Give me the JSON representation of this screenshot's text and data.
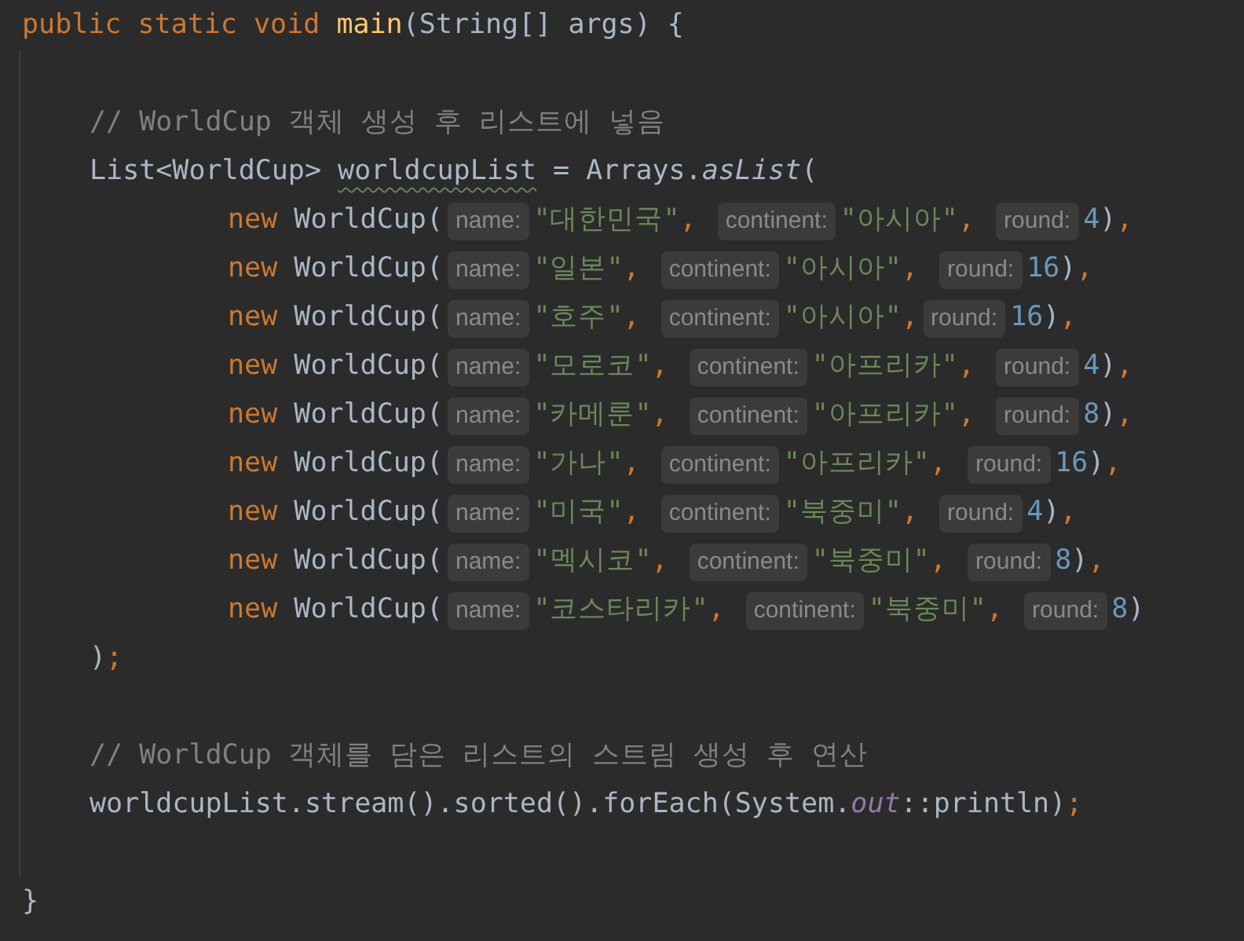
{
  "lines": [
    {
      "kind": "top",
      "tokens": [
        {
          "kind": "keyword",
          "text": "public static void "
        },
        {
          "kind": "method",
          "text": "main"
        },
        {
          "kind": "text",
          "text": "(String[] args) {"
        }
      ]
    },
    {
      "kind": "blank"
    },
    {
      "kind": "body",
      "tokens": [
        {
          "kind": "comment",
          "text": "// WorldCup 객체 생성 후 리스트에 넣음"
        }
      ]
    },
    {
      "kind": "body",
      "tokens": [
        {
          "kind": "text",
          "text": "List<WorldCup> "
        },
        {
          "kind": "typo",
          "text": "worldcupList"
        },
        {
          "kind": "text",
          "text": " = Arrays."
        },
        {
          "kind": "italic",
          "text": "asList"
        },
        {
          "kind": "text",
          "text": "("
        }
      ]
    },
    {
      "kind": "args",
      "tokens": [
        {
          "kind": "keyword",
          "text": "new "
        },
        {
          "kind": "text",
          "text": "WorldCup("
        },
        {
          "kind": "hint",
          "text": "name:"
        },
        {
          "kind": "string",
          "text": "\"대한민국\""
        },
        {
          "kind": "comma",
          "text": ", "
        },
        {
          "kind": "hint",
          "text": "continent:"
        },
        {
          "kind": "string",
          "text": "\"아시아\""
        },
        {
          "kind": "comma",
          "text": ", "
        },
        {
          "kind": "hint",
          "text": "round:"
        },
        {
          "kind": "number",
          "text": "4"
        },
        {
          "kind": "text",
          "text": ")"
        },
        {
          "kind": "comma",
          "text": ","
        }
      ]
    },
    {
      "kind": "args",
      "tokens": [
        {
          "kind": "keyword",
          "text": "new "
        },
        {
          "kind": "text",
          "text": "WorldCup("
        },
        {
          "kind": "hint",
          "text": "name:"
        },
        {
          "kind": "string",
          "text": "\"일본\""
        },
        {
          "kind": "comma",
          "text": ", "
        },
        {
          "kind": "hint",
          "text": "continent:"
        },
        {
          "kind": "string",
          "text": "\"아시아\""
        },
        {
          "kind": "comma",
          "text": ", "
        },
        {
          "kind": "hint",
          "text": "round:"
        },
        {
          "kind": "number",
          "text": "16"
        },
        {
          "kind": "text",
          "text": ")"
        },
        {
          "kind": "comma",
          "text": ","
        }
      ]
    },
    {
      "kind": "args",
      "tokens": [
        {
          "kind": "keyword",
          "text": "new "
        },
        {
          "kind": "text",
          "text": "WorldCup("
        },
        {
          "kind": "hint",
          "text": "name:"
        },
        {
          "kind": "string",
          "text": "\"호주\""
        },
        {
          "kind": "comma",
          "text": ", "
        },
        {
          "kind": "hint",
          "text": "continent:"
        },
        {
          "kind": "string",
          "text": "\"아시아\""
        },
        {
          "kind": "comma",
          "text": ","
        },
        {
          "kind": "hint",
          "text": "round:"
        },
        {
          "kind": "number",
          "text": "16"
        },
        {
          "kind": "text",
          "text": ")"
        },
        {
          "kind": "comma",
          "text": ","
        }
      ]
    },
    {
      "kind": "args",
      "tokens": [
        {
          "kind": "keyword",
          "text": "new "
        },
        {
          "kind": "text",
          "text": "WorldCup("
        },
        {
          "kind": "hint",
          "text": "name:"
        },
        {
          "kind": "string",
          "text": "\"모로코\""
        },
        {
          "kind": "comma",
          "text": ", "
        },
        {
          "kind": "hint",
          "text": "continent:"
        },
        {
          "kind": "string",
          "text": "\"아프리카\""
        },
        {
          "kind": "comma",
          "text": ", "
        },
        {
          "kind": "hint",
          "text": "round:"
        },
        {
          "kind": "number",
          "text": "4"
        },
        {
          "kind": "text",
          "text": ")"
        },
        {
          "kind": "comma",
          "text": ","
        }
      ]
    },
    {
      "kind": "args",
      "tokens": [
        {
          "kind": "keyword",
          "text": "new "
        },
        {
          "kind": "text",
          "text": "WorldCup("
        },
        {
          "kind": "hint",
          "text": "name:"
        },
        {
          "kind": "string",
          "text": "\"카메룬\""
        },
        {
          "kind": "comma",
          "text": ", "
        },
        {
          "kind": "hint",
          "text": "continent:"
        },
        {
          "kind": "string",
          "text": "\"아프리카\""
        },
        {
          "kind": "comma",
          "text": ", "
        },
        {
          "kind": "hint",
          "text": "round:"
        },
        {
          "kind": "number",
          "text": "8"
        },
        {
          "kind": "text",
          "text": ")"
        },
        {
          "kind": "comma",
          "text": ","
        }
      ]
    },
    {
      "kind": "args",
      "tokens": [
        {
          "kind": "keyword",
          "text": "new "
        },
        {
          "kind": "text",
          "text": "WorldCup("
        },
        {
          "kind": "hint",
          "text": "name:"
        },
        {
          "kind": "string",
          "text": "\"가나\""
        },
        {
          "kind": "comma",
          "text": ", "
        },
        {
          "kind": "hint",
          "text": "continent:"
        },
        {
          "kind": "string",
          "text": "\"아프리카\""
        },
        {
          "kind": "comma",
          "text": ", "
        },
        {
          "kind": "hint",
          "text": "round:"
        },
        {
          "kind": "number",
          "text": "16"
        },
        {
          "kind": "text",
          "text": ")"
        },
        {
          "kind": "comma",
          "text": ","
        }
      ]
    },
    {
      "kind": "args",
      "tokens": [
        {
          "kind": "keyword",
          "text": "new "
        },
        {
          "kind": "text",
          "text": "WorldCup("
        },
        {
          "kind": "hint",
          "text": "name:"
        },
        {
          "kind": "string",
          "text": "\"미국\""
        },
        {
          "kind": "comma",
          "text": ", "
        },
        {
          "kind": "hint",
          "text": "continent:"
        },
        {
          "kind": "string",
          "text": "\"북중미\""
        },
        {
          "kind": "comma",
          "text": ", "
        },
        {
          "kind": "hint",
          "text": "round:"
        },
        {
          "kind": "number",
          "text": "4"
        },
        {
          "kind": "text",
          "text": ")"
        },
        {
          "kind": "comma",
          "text": ","
        }
      ]
    },
    {
      "kind": "args",
      "tokens": [
        {
          "kind": "keyword",
          "text": "new "
        },
        {
          "kind": "text",
          "text": "WorldCup("
        },
        {
          "kind": "hint",
          "text": "name:"
        },
        {
          "kind": "string",
          "text": "\"멕시코\""
        },
        {
          "kind": "comma",
          "text": ", "
        },
        {
          "kind": "hint",
          "text": "continent:"
        },
        {
          "kind": "string",
          "text": "\"북중미\""
        },
        {
          "kind": "comma",
          "text": ", "
        },
        {
          "kind": "hint",
          "text": "round:"
        },
        {
          "kind": "number",
          "text": "8"
        },
        {
          "kind": "text",
          "text": ")"
        },
        {
          "kind": "comma",
          "text": ","
        }
      ]
    },
    {
      "kind": "args",
      "tokens": [
        {
          "kind": "keyword",
          "text": "new "
        },
        {
          "kind": "text",
          "text": "WorldCup("
        },
        {
          "kind": "hint",
          "text": "name:"
        },
        {
          "kind": "string",
          "text": "\"코스타리카\""
        },
        {
          "kind": "comma",
          "text": ", "
        },
        {
          "kind": "hint",
          "text": "continent:"
        },
        {
          "kind": "string",
          "text": "\"북중미\""
        },
        {
          "kind": "comma",
          "text": ", "
        },
        {
          "kind": "hint",
          "text": "round:"
        },
        {
          "kind": "number",
          "text": "8"
        },
        {
          "kind": "text",
          "text": ")"
        }
      ]
    },
    {
      "kind": "body",
      "tokens": [
        {
          "kind": "text",
          "text": ")"
        },
        {
          "kind": "comma",
          "text": ";"
        }
      ]
    },
    {
      "kind": "blank"
    },
    {
      "kind": "body",
      "tokens": [
        {
          "kind": "comment",
          "text": "// WorldCup 객체를 담은 리스트의 스트림 생성 후 연산"
        }
      ]
    },
    {
      "kind": "body",
      "tokens": [
        {
          "kind": "text",
          "text": "worldcupList.stream().sorted().forEach(System."
        },
        {
          "kind": "field",
          "text": "out"
        },
        {
          "kind": "text",
          "text": "::println)"
        },
        {
          "kind": "comma",
          "text": ";"
        }
      ]
    },
    {
      "kind": "blank"
    },
    {
      "kind": "top",
      "tokens": [
        {
          "kind": "text",
          "text": "}"
        }
      ]
    }
  ]
}
